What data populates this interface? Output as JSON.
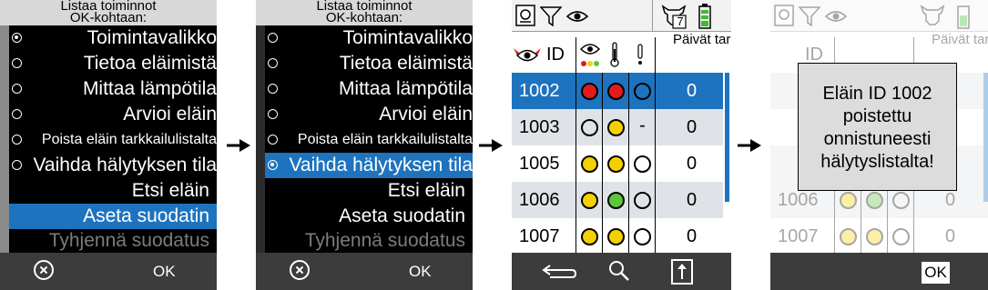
{
  "menu": {
    "header_line1": "Listaa toiminnot",
    "header_line2": "OK-kohtaan:",
    "items": [
      {
        "label": "Toimintavalikko",
        "type": "radio"
      },
      {
        "label": "Tietoa eläimistä",
        "type": "radio"
      },
      {
        "label": "Mittaa lämpötila",
        "type": "radio"
      },
      {
        "label": "Arvioi eläin",
        "type": "radio"
      },
      {
        "label": "Poista eläin tarkkailulistalta",
        "type": "radio"
      },
      {
        "label": "Vaihda hälytyksen tila",
        "type": "radio"
      },
      {
        "label": "Etsi eläin",
        "type": "action"
      },
      {
        "label": "Aseta suodatin",
        "type": "action"
      },
      {
        "label": "Tyhjennä suodatus",
        "type": "action-disabled"
      }
    ],
    "ok_label": "OK"
  },
  "screen1": {
    "selected_radio": "Toimintavalikko",
    "highlighted": "Aseta suodatin"
  },
  "screen2": {
    "selected_radio": "Vaihda hälytyksen tila",
    "highlighted": "Vaihda hälytyksen tila"
  },
  "table": {
    "header_id": "ID",
    "header_count": "Päivät tarkkailussa",
    "badge_number": "7",
    "rows": [
      {
        "id": "1002",
        "dots": [
          "red",
          "red",
          "empty"
        ],
        "count": "0"
      },
      {
        "id": "1003",
        "dots": [
          "empty",
          "yellow",
          "dash"
        ],
        "count": "0"
      },
      {
        "id": "1005",
        "dots": [
          "yellow",
          "yellow",
          "empty"
        ],
        "count": "0"
      },
      {
        "id": "1006",
        "dots": [
          "yellow",
          "green",
          "empty"
        ],
        "count": "0"
      },
      {
        "id": "1007",
        "dots": [
          "yellow",
          "yellow",
          "empty"
        ],
        "count": "0"
      }
    ]
  },
  "dialog": {
    "line1": "Eläin ID 1002",
    "line2": "poistettu",
    "line3": "onnistuneesti",
    "line4": "hälytyslistalta!",
    "ok_label": "OK"
  },
  "colors": {
    "accent": "#1e73be",
    "red": "#e21b1b",
    "yellow": "#f5d000",
    "green": "#5cc63a"
  }
}
